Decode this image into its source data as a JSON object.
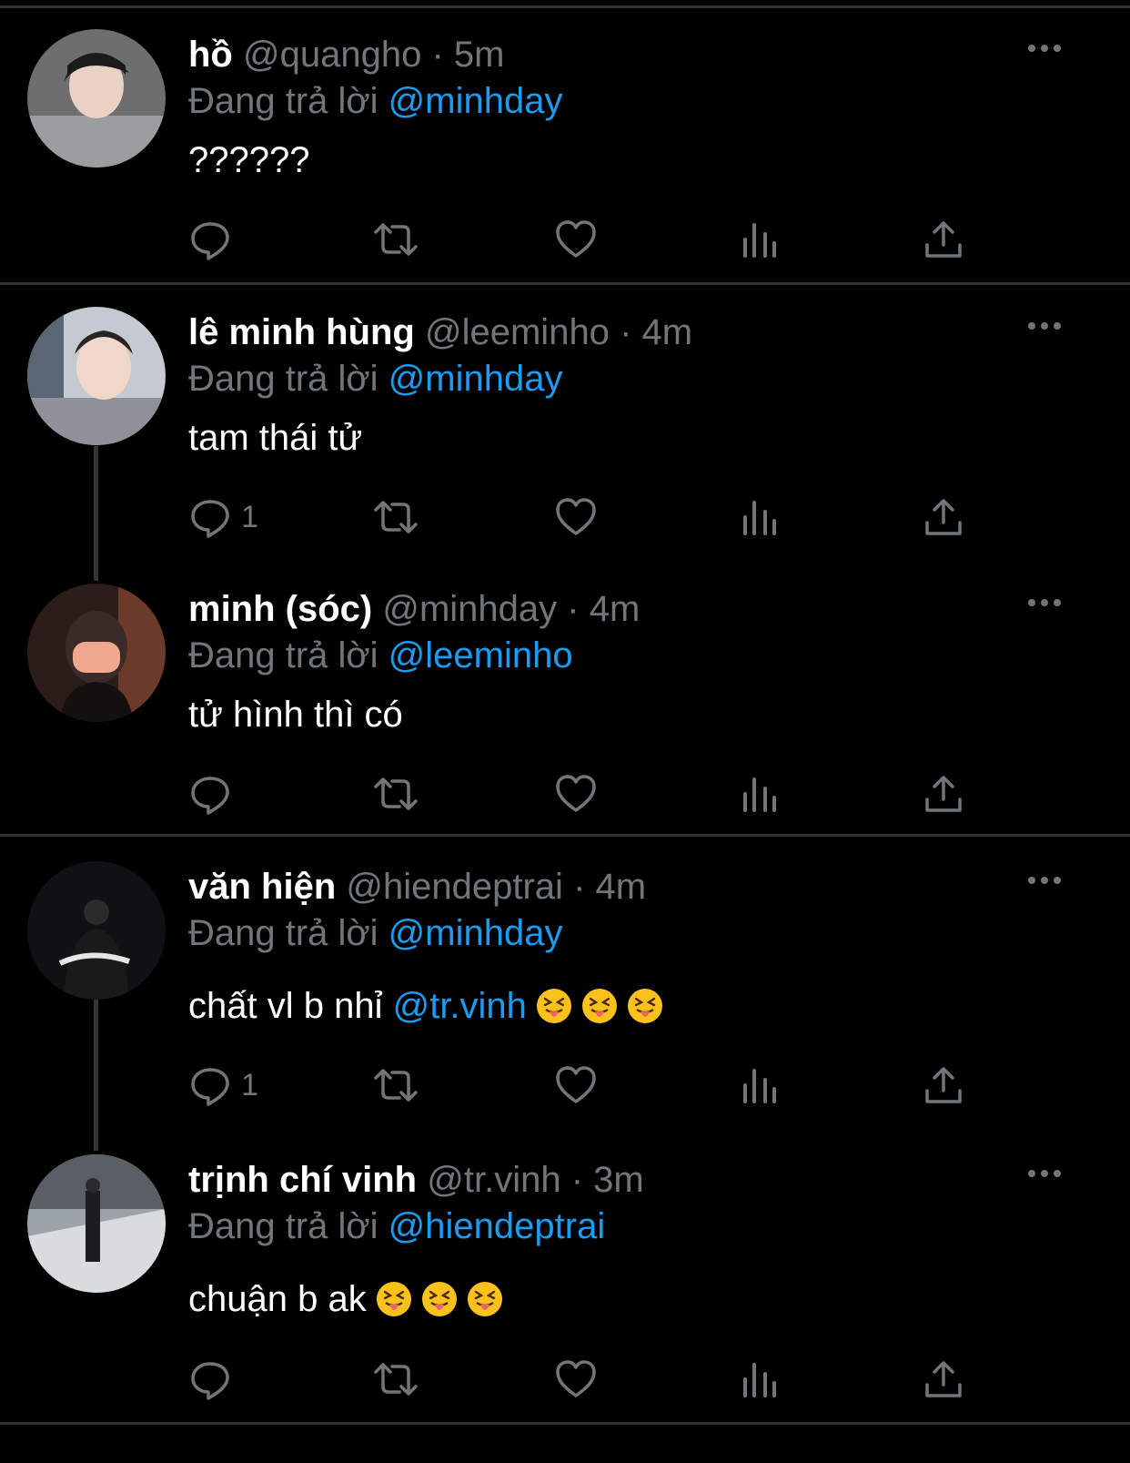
{
  "reply_prefix": "Đang trả lời",
  "tweets": [
    {
      "name": "hồ",
      "handle": "@quangho",
      "dot": "·",
      "time": "5m",
      "reply_to": "@minhday",
      "text": "??????",
      "reply_count": "",
      "avatar_bg": "#6e6e6e"
    },
    {
      "name": "lê minh hùng",
      "handle": "@leeminho",
      "dot": "·",
      "time": "4m",
      "reply_to": "@minhday",
      "text": "tam thái tử",
      "reply_count": "1",
      "avatar_bg": "#8a8f96"
    },
    {
      "name": "minh (sóc)",
      "handle": "@minhday",
      "dot": "·",
      "time": "4m",
      "reply_to": "@leeminho",
      "text": "tử hình thì có",
      "reply_count": "",
      "avatar_bg": "#2c1d1b"
    },
    {
      "name": "văn hiện",
      "handle": "@hiendeptrai",
      "dot": "·",
      "time": "4m",
      "reply_to": "@minhday",
      "text": "chất vl b nhỉ",
      "mention": "@tr.vinh",
      "emoji_count": 3,
      "reply_count": "1",
      "avatar_bg": "#0f1114"
    },
    {
      "name": "trịnh chí vinh",
      "handle": "@tr.vinh",
      "dot": "·",
      "time": "3m",
      "reply_to": "@hiendeptrai",
      "text": "chuận b ak",
      "emoji_count": 3,
      "reply_count": "",
      "avatar_bg": "#9ca3a9"
    }
  ],
  "colors": {
    "background": "#000000",
    "divider": "#2f3336",
    "muted": "#71767b",
    "link": "#1d9bf0",
    "text": "#ffffff"
  },
  "icons": [
    "reply-icon",
    "retweet-icon",
    "like-icon",
    "analytics-icon",
    "share-icon",
    "more-icon"
  ]
}
